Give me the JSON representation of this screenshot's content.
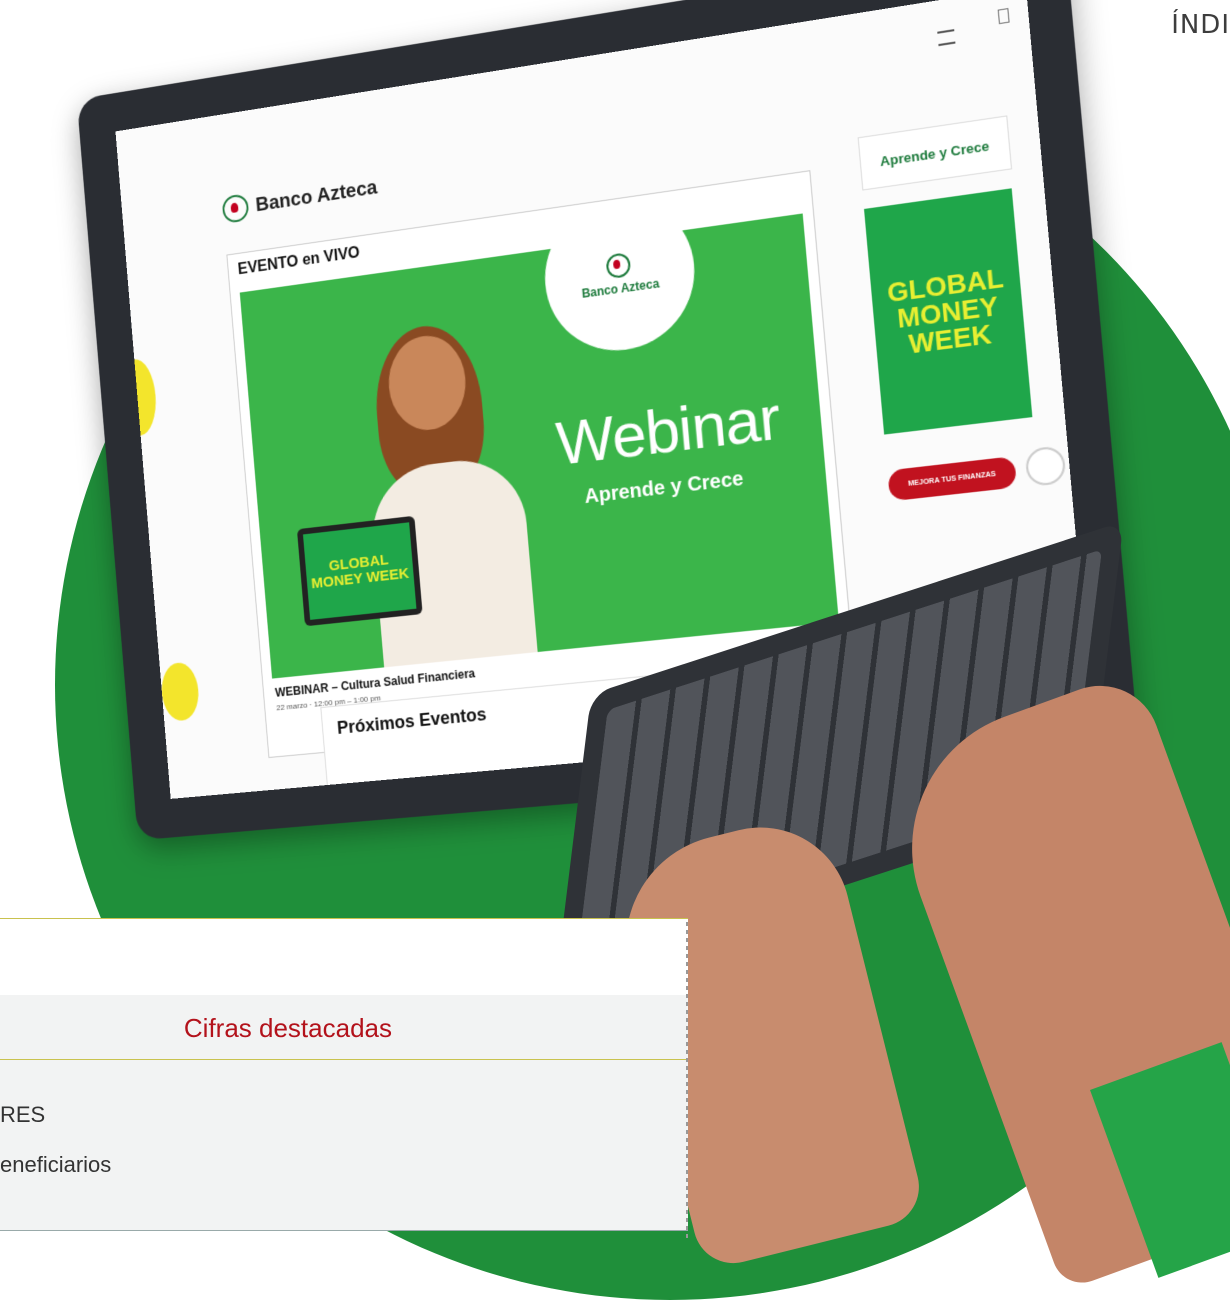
{
  "corner_label": "ÍNDI",
  "screen": {
    "logo_text": "Banco Azteca",
    "live_section_title": "EVENTO en VIVO",
    "banner": {
      "logo_text": "Banco Azteca",
      "headline": "Webinar",
      "tagline": "Aprende y Crece",
      "laptop_screen_text": "GLOBAL MONEY WEEK"
    },
    "event_title": "WEBINAR – Cultura Salud Financiera",
    "event_time": "22 marzo · 12:00 pm – 1:00 pm",
    "sidebar_button": "Aprende y Crece",
    "sidebar_tile_text": "GLOBAL MONEY WEEK",
    "cta_label": "MEJORA TUS FINANZAS",
    "upcoming_title": "Próximos Eventos"
  },
  "panel": {
    "subheading": "Cifras destacadas",
    "rows": [
      "RES",
      "eneficiarios"
    ]
  },
  "colors": {
    "brand_green": "#1f8f3a",
    "banner_green": "#3bb54a",
    "brand_red": "#b3121b",
    "accent_yellow": "#f3e52c"
  }
}
